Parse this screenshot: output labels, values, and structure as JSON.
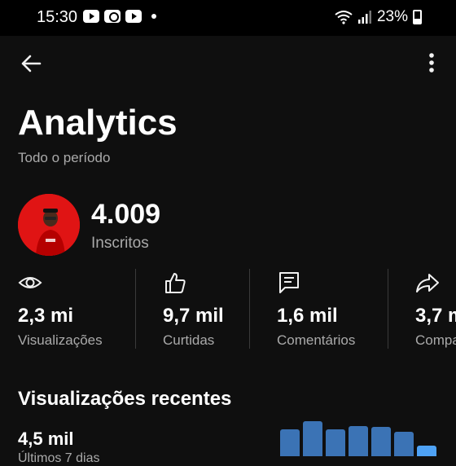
{
  "status_bar": {
    "time": "15:30",
    "battery": "23%",
    "icons": [
      "youtube-notification-icon",
      "app-notification-icon",
      "youtube-notification-icon",
      "dot-icon",
      "wifi-icon",
      "signal-icon",
      "battery-icon"
    ]
  },
  "header": {
    "back_icon": "arrow-left-icon",
    "more_icon": "more-vertical-icon"
  },
  "page": {
    "title": "Analytics",
    "period": "Todo o período"
  },
  "channel": {
    "subscribers": "4.009",
    "subscribers_label": "Inscritos"
  },
  "stats": [
    {
      "icon": "eye-icon",
      "value": "2,3 mi",
      "label": "Visualizações"
    },
    {
      "icon": "thumbs-up-icon",
      "value": "9,7 mil",
      "label": "Curtidas"
    },
    {
      "icon": "comment-icon",
      "value": "1,6 mil",
      "label": "Comentários"
    },
    {
      "icon": "share-icon",
      "value": "3,7 m",
      "label": "Compa"
    }
  ],
  "recent": {
    "title": "Visualizações recentes",
    "value": "4,5 mil",
    "sub": "Últimos 7 dias",
    "bars": [
      0.55,
      0.72,
      0.55,
      0.62,
      0.6,
      0.5,
      0.22
    ],
    "colors": {
      "bar": "#3b73b5",
      "highlight": "#4ea2f5"
    }
  }
}
